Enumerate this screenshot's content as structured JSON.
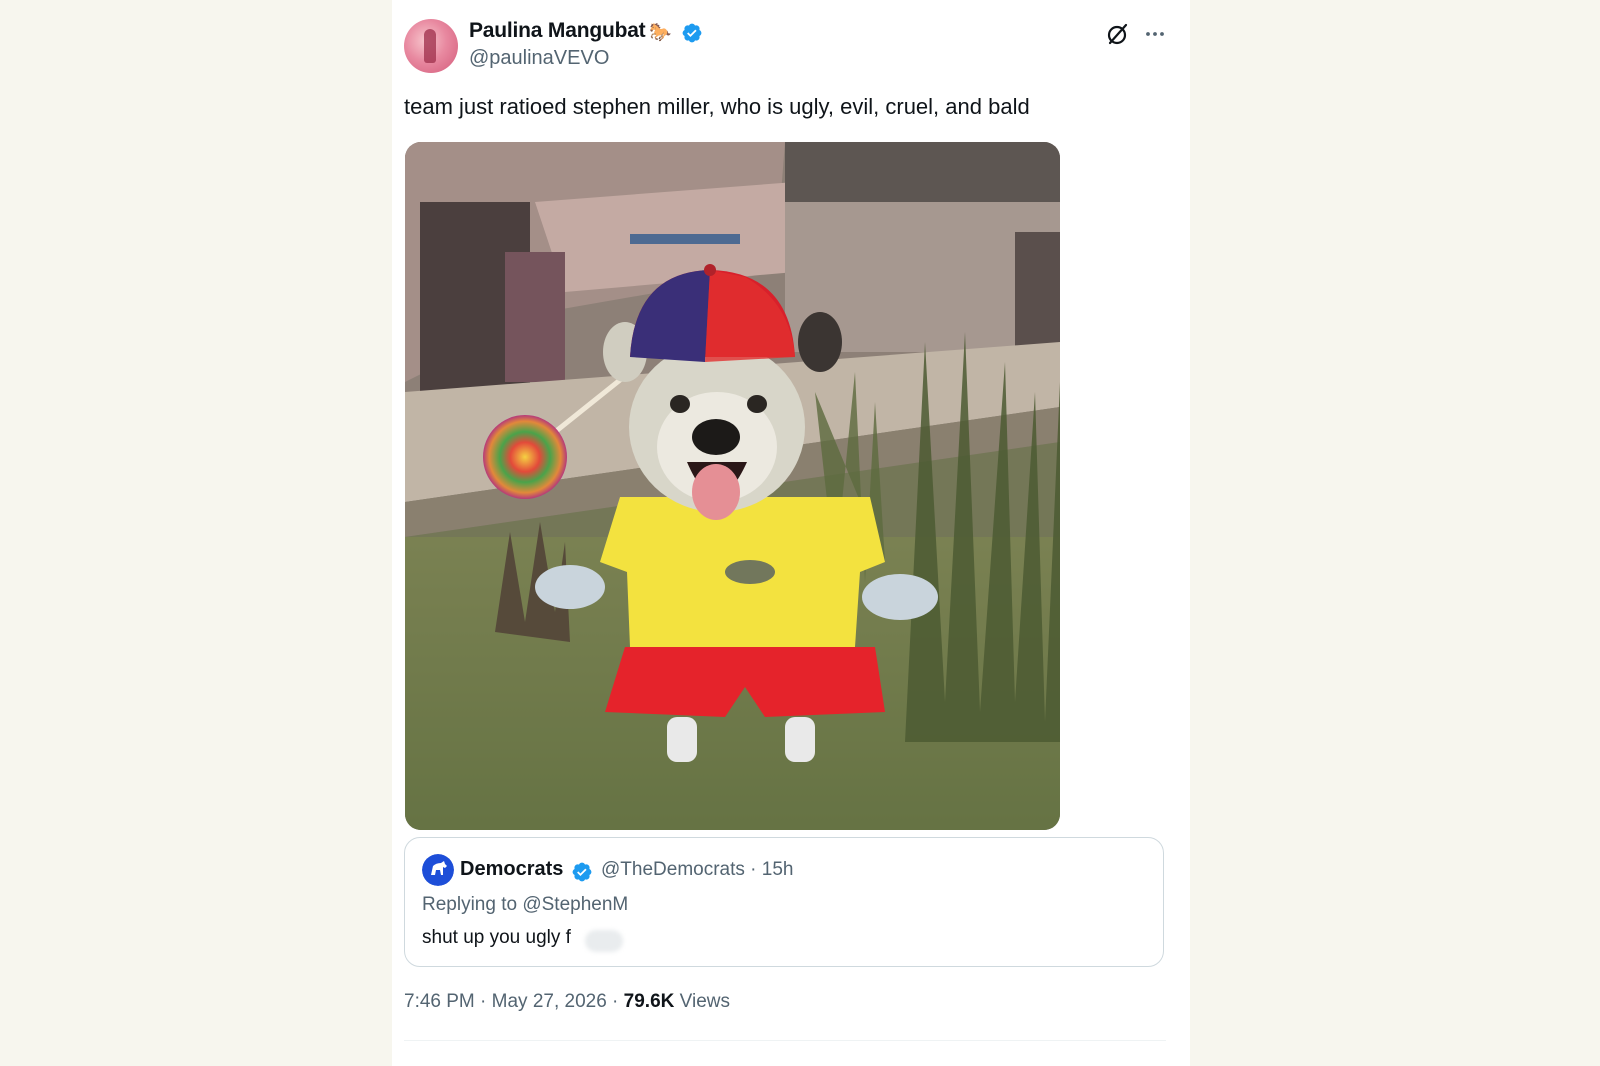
{
  "author": {
    "display_name": "Paulina Mangubat",
    "emoji": "🐎",
    "handle": "@paulinaVEVO",
    "verified": true
  },
  "tweet": {
    "text": "team just ratioed stephen miller, who is ugly, evil, cruel, and bald"
  },
  "media": {
    "icon": "photo"
  },
  "quoted_tweet": {
    "display_name": "Democrats",
    "verified": true,
    "meta": "@TheDemocrats · 15h",
    "replying_to": "Replying to @StephenM",
    "text": "shut up you ugly f"
  },
  "footer": {
    "timestamp": "7:46 PM · May 27, 2026 · ",
    "views_count": "79.6K",
    "views_label": " Views"
  },
  "colors": {
    "verified": "#1d9bf0",
    "text_primary": "#0f1419",
    "text_secondary": "#536471",
    "border": "#cfd9de",
    "background": "#f7f6ee"
  }
}
